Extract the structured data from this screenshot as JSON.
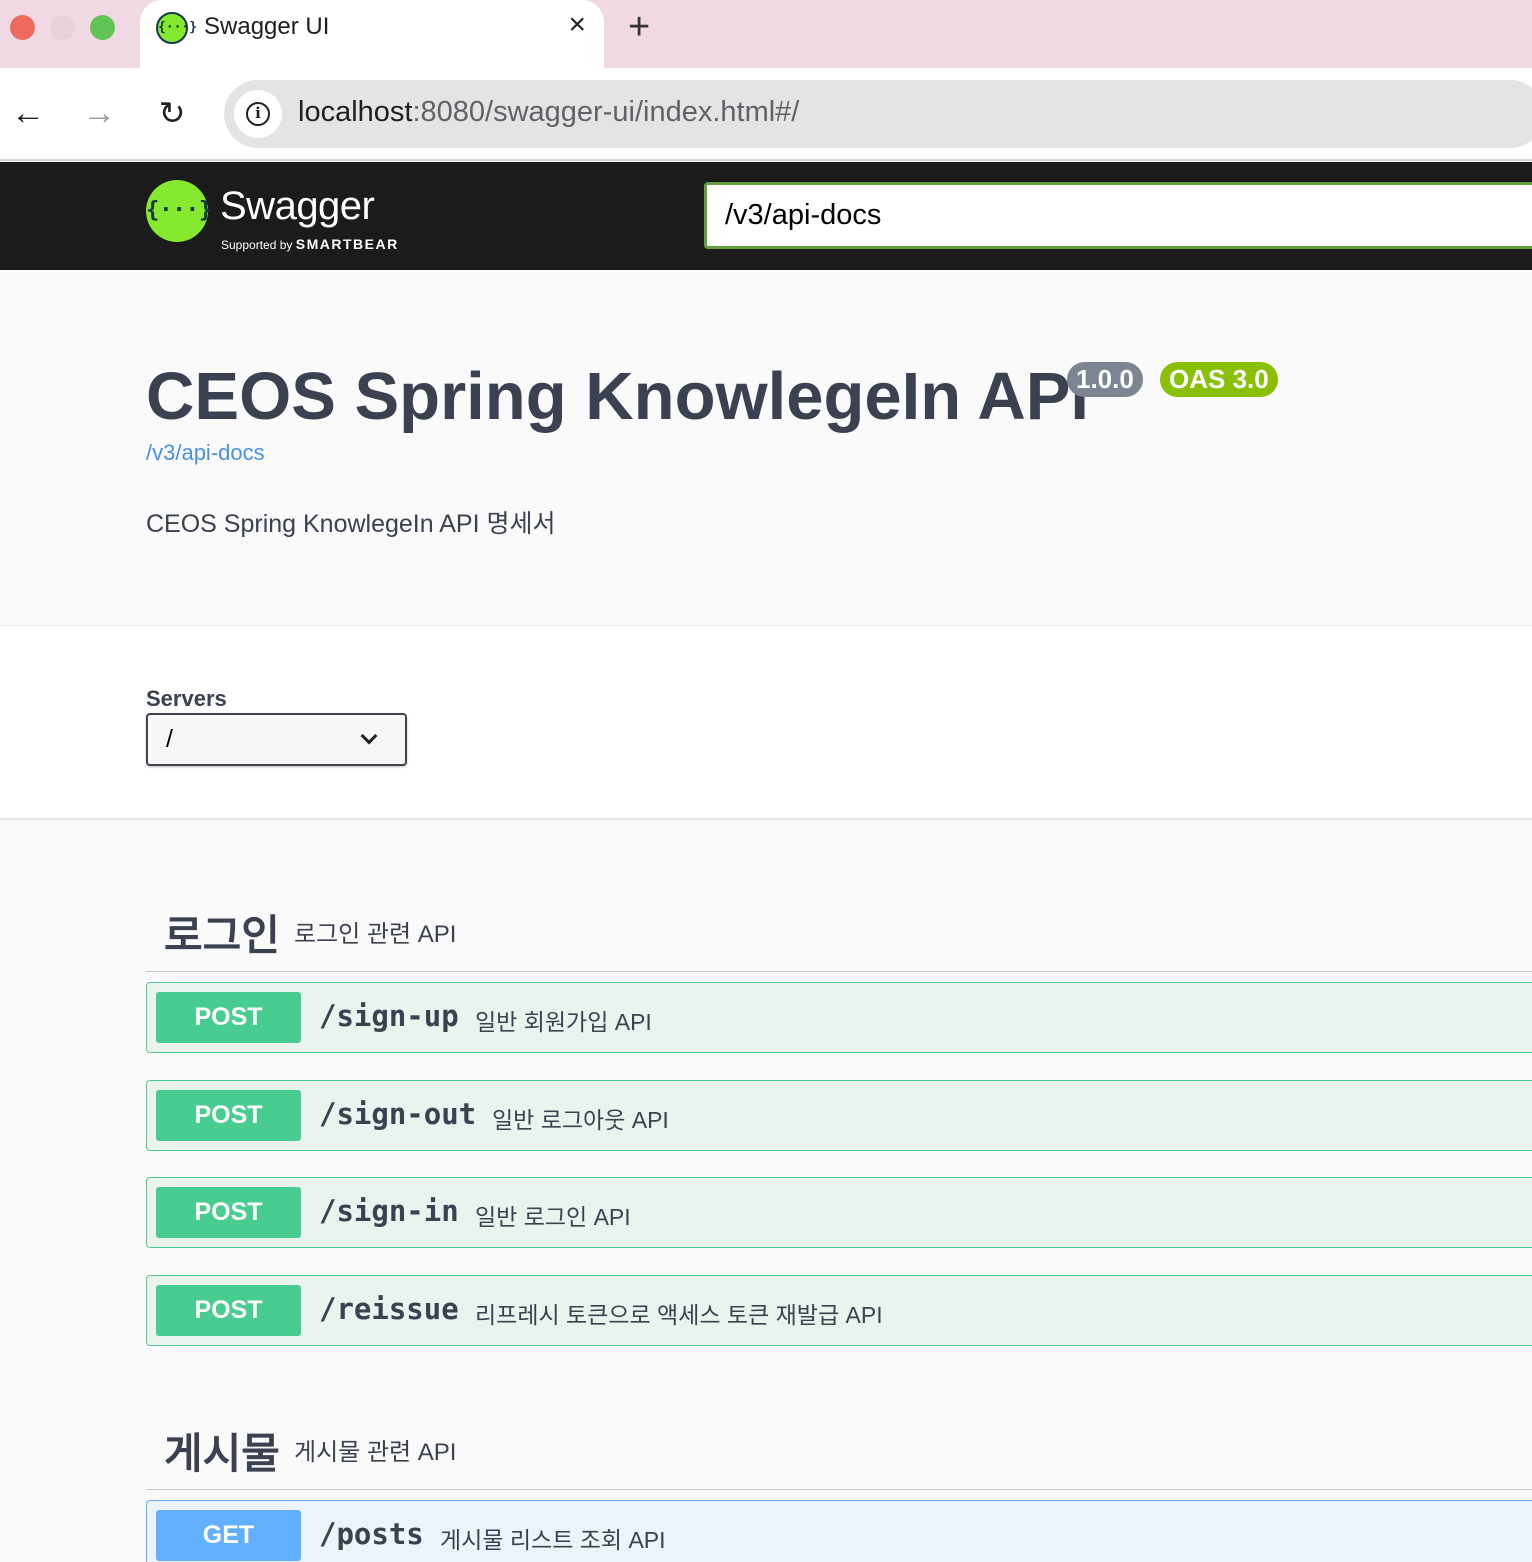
{
  "browser": {
    "tab_title": "Swagger UI",
    "tab_favicon": "{···}",
    "url_host": "localhost",
    "url_rest": ":8080/swagger-ui/index.html#/"
  },
  "topbar": {
    "logo_glyph": "{···}",
    "logo_word": "Swagger",
    "logo_sub_prefix": "Supported by",
    "logo_sub_brand": "SMARTBEAR",
    "spec_url": "/v3/api-docs"
  },
  "info": {
    "title": "CEOS Spring KnowlegeIn API",
    "version": "1.0.0",
    "oas": "OAS 3.0",
    "spec_link": "/v3/api-docs",
    "description": "CEOS Spring KnowlegeIn API 명세서"
  },
  "servers": {
    "label": "Servers",
    "selected": "/"
  },
  "tags": [
    {
      "name": "로그인",
      "description": "로그인 관련 API",
      "operations": [
        {
          "method": "POST",
          "path": "/sign-up",
          "summary": "일반 회원가입 API"
        },
        {
          "method": "POST",
          "path": "/sign-out",
          "summary": "일반 로그아웃 API"
        },
        {
          "method": "POST",
          "path": "/sign-in",
          "summary": "일반 로그인 API"
        },
        {
          "method": "POST",
          "path": "/reissue",
          "summary": "리프레시 토큰으로 액세스 토큰 재발급 API"
        }
      ]
    },
    {
      "name": "게시물",
      "description": "게시물 관련 API",
      "operations": [
        {
          "method": "GET",
          "path": "/posts",
          "summary": "게시물 리스트 조회 API"
        }
      ]
    }
  ],
  "colors": {
    "post": "#49cc90",
    "get": "#61affe",
    "swagger_green": "#85ea2d",
    "tab_strip": "#f1d9e4"
  }
}
